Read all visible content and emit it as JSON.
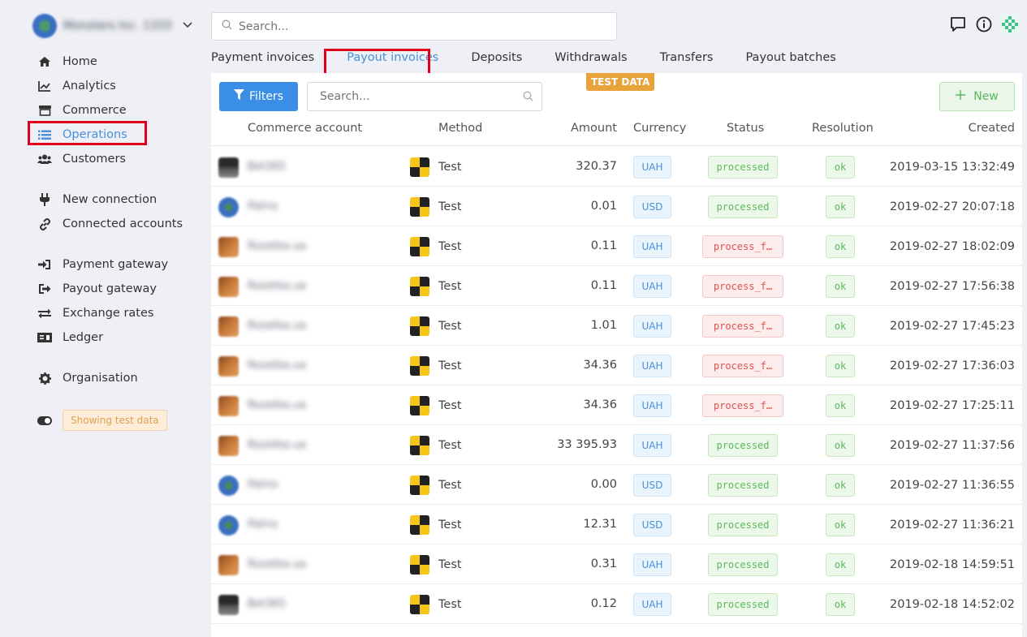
{
  "sidebar": {
    "org_name": "Monsters Inc. 1333",
    "items": [
      {
        "label": "Home",
        "icon": "home-icon"
      },
      {
        "label": "Analytics",
        "icon": "analytics-icon"
      },
      {
        "label": "Commerce",
        "icon": "store-icon"
      },
      {
        "label": "Operations",
        "icon": "list-icon",
        "active": true
      },
      {
        "label": "Customers",
        "icon": "users-icon"
      },
      {
        "label": "New connection",
        "icon": "plug-icon"
      },
      {
        "label": "Connected accounts",
        "icon": "link-icon"
      },
      {
        "label": "Payment gateway",
        "icon": "sign-in-icon"
      },
      {
        "label": "Payout gateway",
        "icon": "sign-out-icon"
      },
      {
        "label": "Exchange rates",
        "icon": "exchange-icon"
      },
      {
        "label": "Ledger",
        "icon": "money-icon"
      },
      {
        "label": "Organisation",
        "icon": "gear-icon"
      }
    ],
    "test_badge": "Showing test data"
  },
  "top_search": {
    "placeholder": "Search..."
  },
  "tabs": [
    "Payment invoices",
    "Payout invoices",
    "Deposits",
    "Withdrawals",
    "Transfers",
    "Payout batches"
  ],
  "active_tab": "Payout invoices",
  "panel": {
    "test_data_tag": "TEST DATA",
    "filters_label": "Filters",
    "search_placeholder": "Search...",
    "new_label": "New"
  },
  "table": {
    "headers": {
      "account": "Commerce account",
      "method": "Method",
      "amount": "Amount",
      "currency": "Currency",
      "status": "Status",
      "resolution": "Resolution",
      "created": "Created"
    },
    "rows": [
      {
        "avatar": "person",
        "account": "Bet365",
        "method": "Test",
        "amount": "320.37",
        "currency": "UAH",
        "status": "processed",
        "resolution": "ok",
        "created": "2019-03-15 13:32:49"
      },
      {
        "avatar": "globe",
        "account": "Patrio",
        "method": "Test",
        "amount": "0.01",
        "currency": "USD",
        "status": "processed",
        "resolution": "ok",
        "created": "2019-02-27 20:07:18"
      },
      {
        "avatar": "orange",
        "account": "Rozetka.ua",
        "method": "Test",
        "amount": "0.11",
        "currency": "UAH",
        "status": "process_f…",
        "resolution": "ok",
        "created": "2019-02-27 18:02:09"
      },
      {
        "avatar": "orange",
        "account": "Rozetka.ua",
        "method": "Test",
        "amount": "0.11",
        "currency": "UAH",
        "status": "process_f…",
        "resolution": "ok",
        "created": "2019-02-27 17:56:38"
      },
      {
        "avatar": "orange",
        "account": "Rozetka.ua",
        "method": "Test",
        "amount": "1.01",
        "currency": "UAH",
        "status": "process_f…",
        "resolution": "ok",
        "created": "2019-02-27 17:45:23"
      },
      {
        "avatar": "orange",
        "account": "Rozetka.ua",
        "method": "Test",
        "amount": "34.36",
        "currency": "UAH",
        "status": "process_f…",
        "resolution": "ok",
        "created": "2019-02-27 17:36:03"
      },
      {
        "avatar": "orange",
        "account": "Rozetka.ua",
        "method": "Test",
        "amount": "34.36",
        "currency": "UAH",
        "status": "process_f…",
        "resolution": "ok",
        "created": "2019-02-27 17:25:11"
      },
      {
        "avatar": "orange",
        "account": "Rozetka.ua",
        "method": "Test",
        "amount": "33 395.93",
        "currency": "UAH",
        "status": "processed",
        "resolution": "ok",
        "created": "2019-02-27 11:37:56"
      },
      {
        "avatar": "globe",
        "account": "Patrio",
        "method": "Test",
        "amount": "0.00",
        "currency": "USD",
        "status": "processed",
        "resolution": "ok",
        "created": "2019-02-27 11:36:55"
      },
      {
        "avatar": "globe",
        "account": "Patrio",
        "method": "Test",
        "amount": "12.31",
        "currency": "USD",
        "status": "processed",
        "resolution": "ok",
        "created": "2019-02-27 11:36:21"
      },
      {
        "avatar": "orange",
        "account": "Rozetka.ua",
        "method": "Test",
        "amount": "0.31",
        "currency": "UAH",
        "status": "processed",
        "resolution": "ok",
        "created": "2019-02-18 14:59:51"
      },
      {
        "avatar": "person",
        "account": "Bet365",
        "method": "Test",
        "amount": "0.12",
        "currency": "UAH",
        "status": "processed",
        "resolution": "ok",
        "created": "2019-02-18 14:52:02"
      }
    ]
  }
}
